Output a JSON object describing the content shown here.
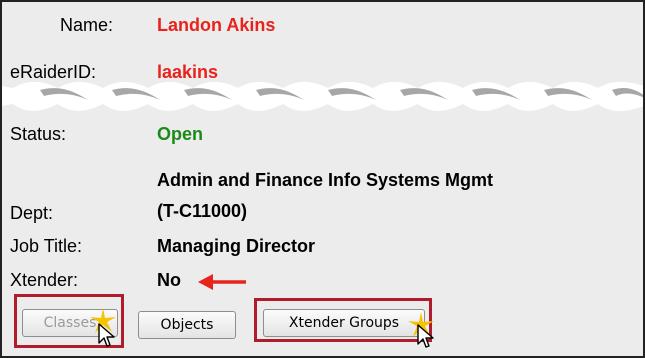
{
  "fields": {
    "name": {
      "label": "Name:",
      "value": "Landon Akins"
    },
    "eraider": {
      "label": "eRaiderID:",
      "value": "laakins"
    },
    "status": {
      "label": "Status:",
      "value": "Open"
    },
    "dept": {
      "label": "Dept:",
      "value_line1": "Admin and Finance Info Systems Mgmt",
      "value_line2": "(T-C11000)"
    },
    "job_title": {
      "label": "Job Title:",
      "value": "Managing Director"
    },
    "xtender": {
      "label": "Xtender:",
      "value": "No"
    }
  },
  "buttons": {
    "classes": "Classes",
    "objects": "Objects",
    "xtender_groups": "Xtender Groups"
  },
  "colors": {
    "name_value": "#e8231c",
    "eraider_value": "#e8231c",
    "status_value": "#1a8a1a",
    "arrow": "#e8231c",
    "highlight_box": "#b01c2b",
    "sparkle": "#f5c400"
  },
  "icons": [
    "tear-divider",
    "left-arrow-icon",
    "sparkle-icon",
    "pointer-cursor-icon"
  ]
}
